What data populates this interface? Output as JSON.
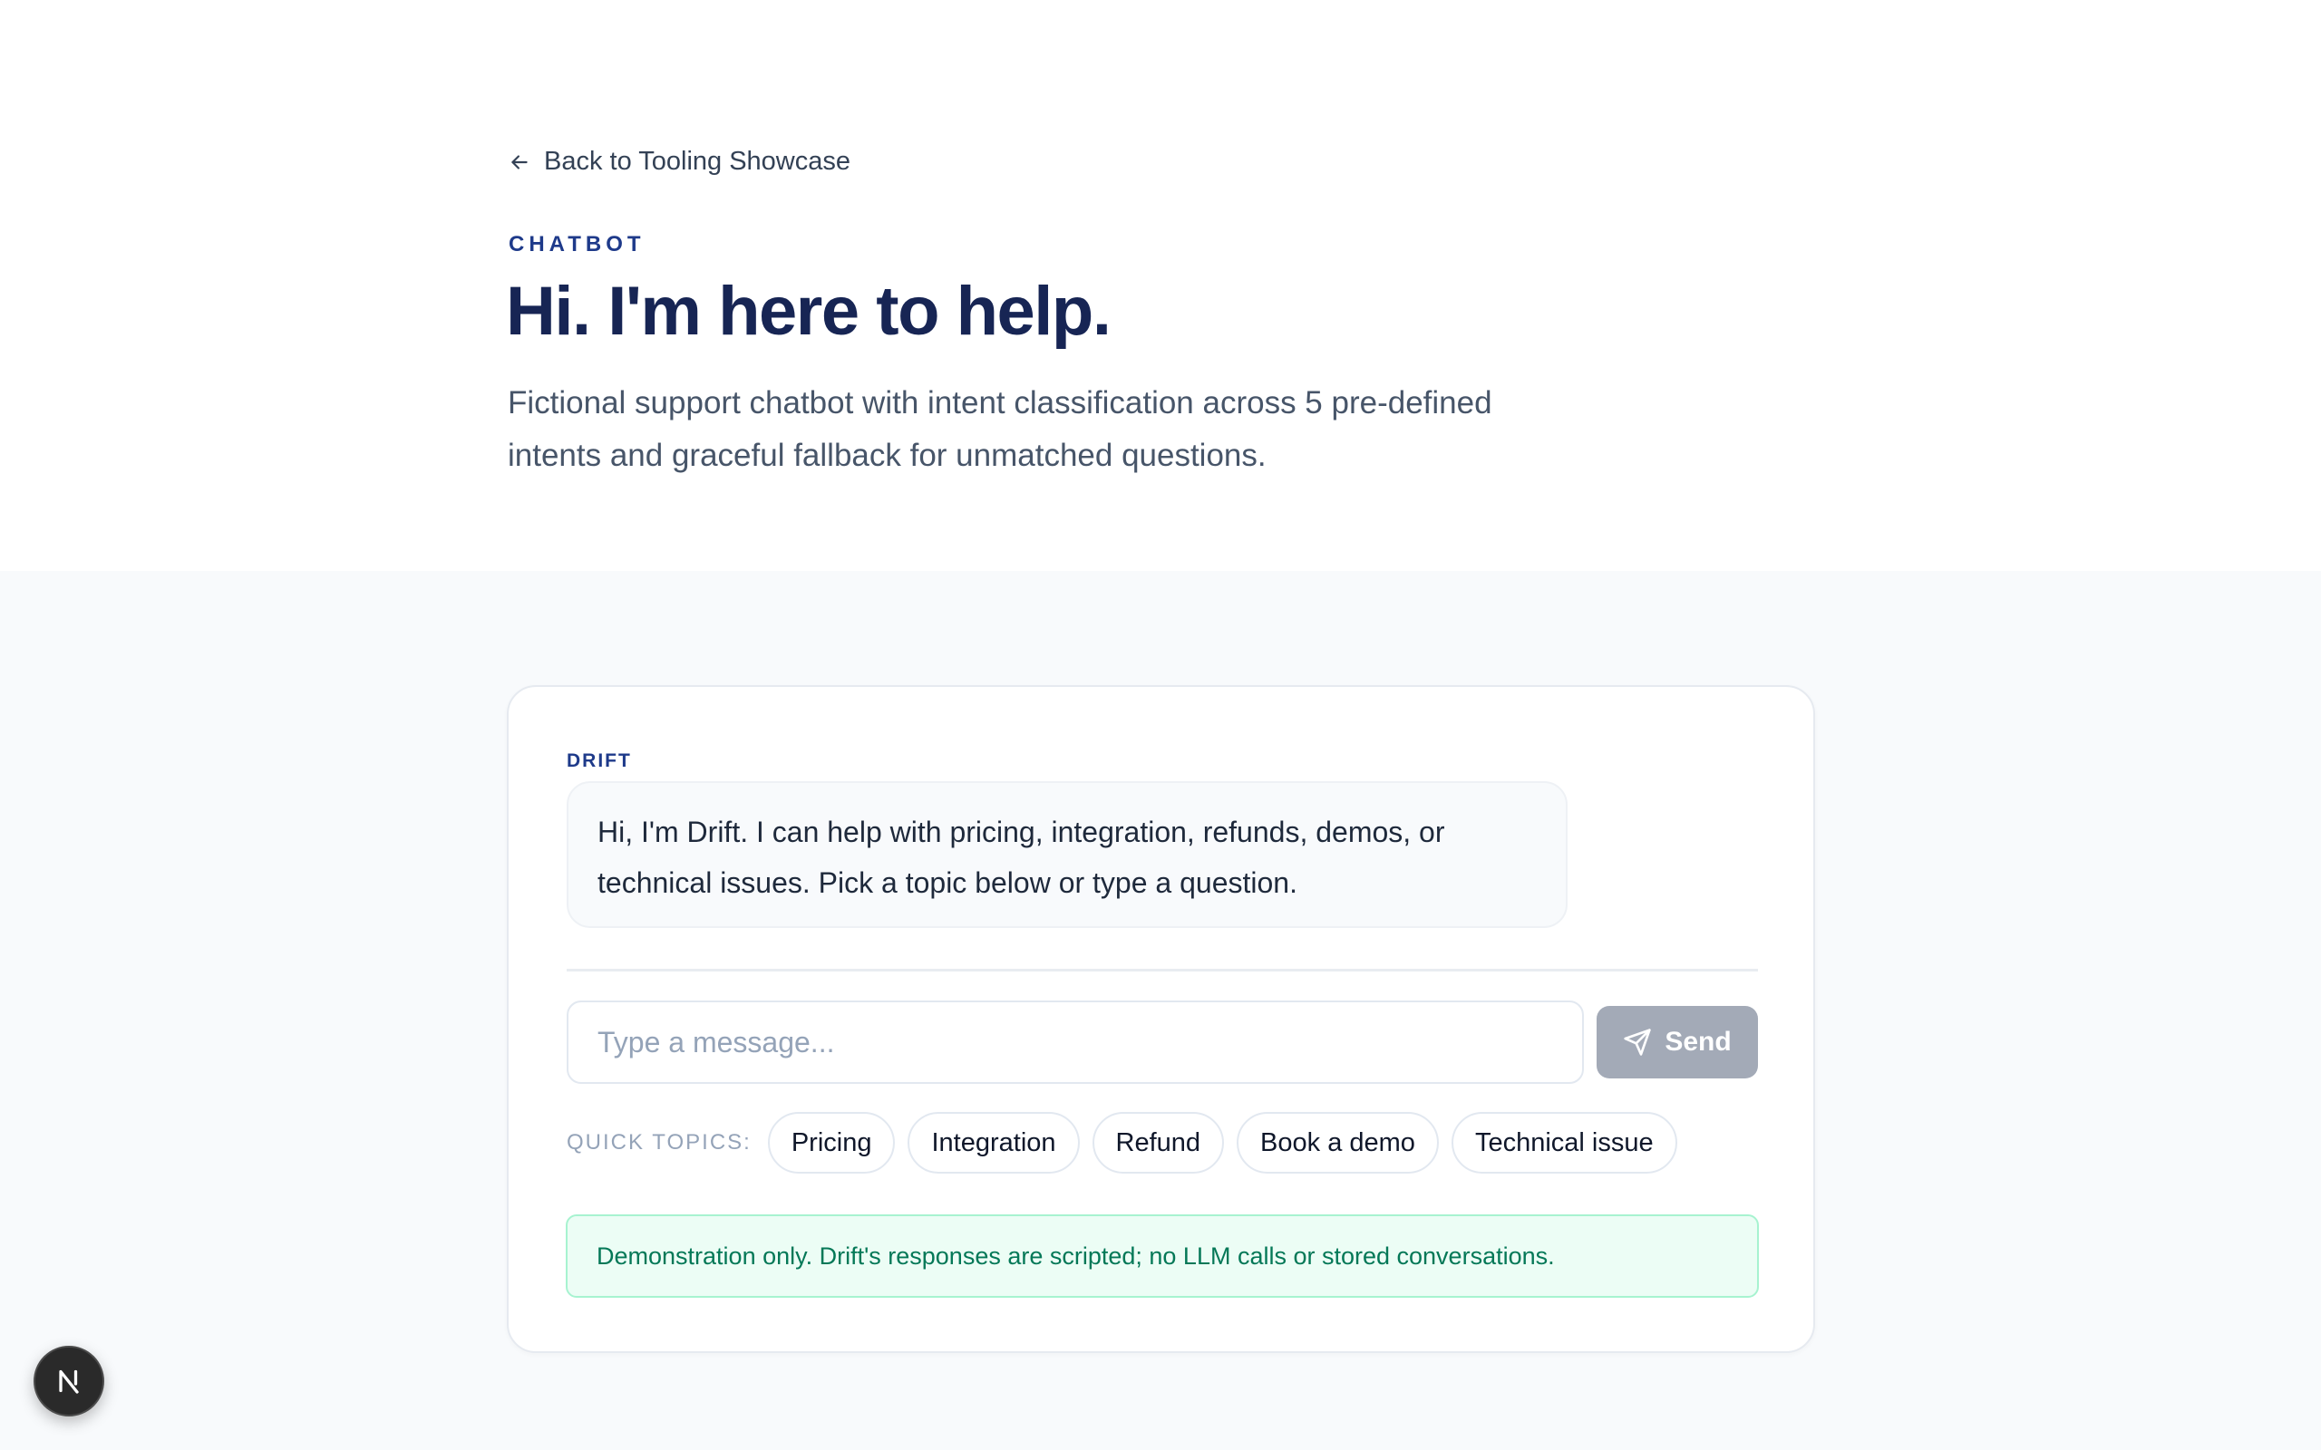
{
  "nav": {
    "back_label": "Back to Tooling Showcase"
  },
  "hero": {
    "eyebrow": "CHATBOT",
    "title": "Hi. I'm here to help.",
    "subtitle": "Fictional support chatbot with intent classification across 5 pre-defined intents and graceful fallback for unmatched questions."
  },
  "chat": {
    "sender": "DRIFT",
    "message": "Hi, I'm Drift. I can help with pricing, integration, refunds, demos, or technical issues. Pick a topic below or type a question.",
    "input_placeholder": "Type a message...",
    "input_value": "",
    "send_label": "Send",
    "quick_topics_label": "QUICK TOPICS:",
    "quick_topics": [
      "Pricing",
      "Integration",
      "Refund",
      "Book a demo",
      "Technical issue"
    ],
    "notice": "Demonstration only. Drift's responses are scripted; no LLM calls or stored conversations."
  },
  "dev_badge": {
    "letter": "N",
    "icon": "nextjs-icon"
  },
  "colors": {
    "accent": "#1e3a8a",
    "title": "#172554",
    "send_disabled": "#a3aab7",
    "notice_bg": "#ecfdf5",
    "notice_text": "#047857"
  }
}
